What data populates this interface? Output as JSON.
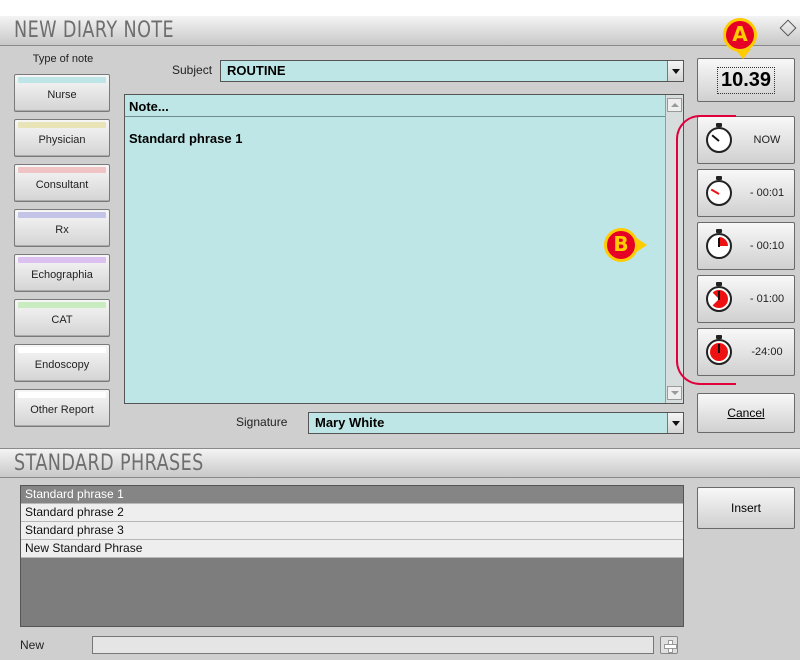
{
  "window": {
    "title": "NEW DIARY NOTE"
  },
  "sidebar": {
    "header": "Type of note",
    "items": [
      {
        "label": "Nurse",
        "color": "#bfe6e6"
      },
      {
        "label": "Physician",
        "color": "#e8e4b8"
      },
      {
        "label": "Consultant",
        "color": "#f0c4c4"
      },
      {
        "label": "Rx",
        "color": "#c4c4e8"
      },
      {
        "label": "Echographia",
        "color": "#dcc0f0"
      },
      {
        "label": "CAT",
        "color": "#c8ecc0"
      },
      {
        "label": "Endoscopy",
        "color": "#ffffff"
      },
      {
        "label": "Other Report",
        "color": "#ffffff"
      }
    ]
  },
  "form": {
    "subject_label": "Subject",
    "subject_value": "ROUTINE",
    "note_header": "Note...",
    "note_content": "Standard phrase 1",
    "signature_label": "Signature",
    "signature_value": "Mary White"
  },
  "time": {
    "current": "10.39",
    "buttons": [
      {
        "label": "NOW",
        "icon": "stopwatch-now-icon"
      },
      {
        "label": "- 00:01",
        "icon": "stopwatch-1min-icon"
      },
      {
        "label": "- 00:10",
        "icon": "stopwatch-10min-icon"
      },
      {
        "label": "- 01:00",
        "icon": "stopwatch-1h-icon"
      },
      {
        "label": "-24:00",
        "icon": "stopwatch-24h-icon"
      }
    ]
  },
  "actions": {
    "cancel": "Cancel",
    "insert": "Insert"
  },
  "phrases": {
    "title": "STANDARD PHRASES",
    "items": [
      "Standard phrase 1",
      "Standard phrase 2",
      "Standard phrase 3",
      "New Standard Phrase"
    ],
    "selected_index": 0,
    "new_label": "New"
  },
  "annotations": {
    "a": "A",
    "b": "B",
    "color": "#e60026",
    "border": "#ffcc00"
  }
}
